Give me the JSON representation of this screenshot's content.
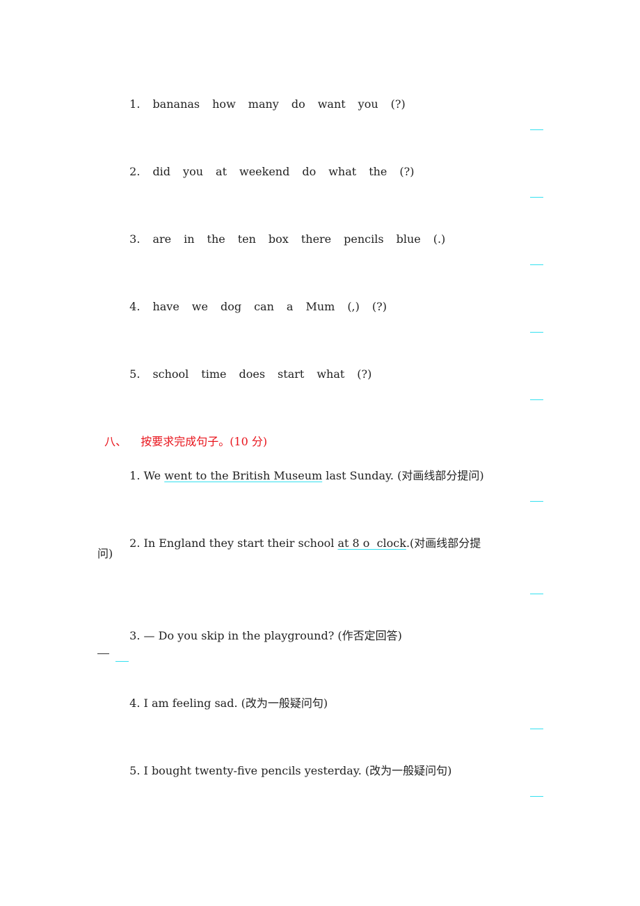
{
  "accent_color": "#33e0f0",
  "heading_color": "#e8141c",
  "part7": {
    "items": [
      {
        "num": "1.",
        "words": [
          "bananas",
          "how",
          "many",
          "do",
          "want",
          "you",
          "(?)"
        ]
      },
      {
        "num": "2.",
        "words": [
          "did",
          "you",
          "at",
          "weekend",
          "do",
          "what",
          "the",
          "(?)"
        ]
      },
      {
        "num": "3.",
        "words": [
          "are",
          "in",
          "the",
          "ten",
          "box",
          "there",
          "pencils",
          "blue",
          "(.)"
        ]
      },
      {
        "num": "4.",
        "words": [
          "have",
          "we",
          "dog",
          "can",
          "a",
          "Mum",
          "(,)",
          "(?)"
        ]
      },
      {
        "num": "5.",
        "words": [
          "school",
          "time",
          "does",
          "start",
          "what",
          "(?)"
        ]
      }
    ]
  },
  "part8": {
    "heading_num": "八、",
    "heading_text": "按要求完成句子。(10 分)",
    "items": [
      {
        "num": "1.",
        "pre": "We ",
        "underlined": "went to the British Museum",
        "post": " last Sunday. (对画线部分提问)"
      },
      {
        "num": "2.",
        "pre": "In England they start their school ",
        "underlined": "at 8 o  clock",
        "post": ".(对画线部分提",
        "wrap": "问)"
      },
      {
        "num": "3.",
        "text": "— Do you skip in the playground? (作否定回答)",
        "answer_prefix": "—"
      },
      {
        "num": "4.",
        "text": "I am feeling sad. (改为一般疑问句)"
      },
      {
        "num": "5.",
        "text": "I bought twenty-five pencils yesterday. (改为一般疑问句)"
      }
    ]
  }
}
